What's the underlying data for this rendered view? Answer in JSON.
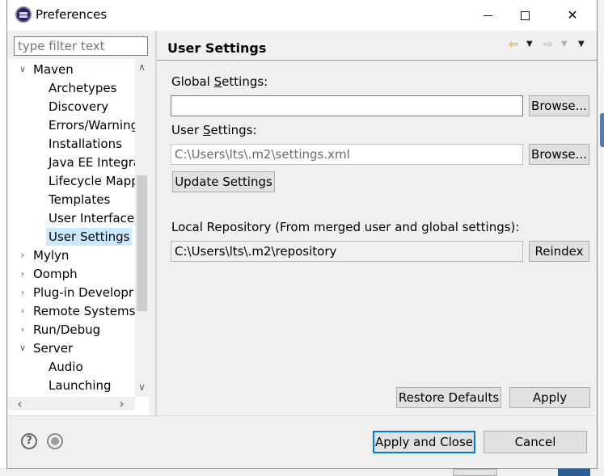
{
  "window": {
    "title": "Preferences",
    "minimize_glyph": "—",
    "close_glyph": "✕"
  },
  "filter": {
    "placeholder": "type filter text"
  },
  "tree": {
    "items": [
      {
        "label": "Maven",
        "expanded": true
      },
      {
        "label": "Archetypes"
      },
      {
        "label": "Discovery"
      },
      {
        "label": "Errors/Warning"
      },
      {
        "label": "Installations"
      },
      {
        "label": "Java EE Integra"
      },
      {
        "label": "Lifecycle Mapp"
      },
      {
        "label": "Templates"
      },
      {
        "label": "User Interface"
      },
      {
        "label": "User Settings",
        "selected": true
      },
      {
        "label": "Mylyn",
        "expanded": false
      },
      {
        "label": "Oomph",
        "expanded": false
      },
      {
        "label": "Plug-in Developr",
        "expanded": false
      },
      {
        "label": "Remote Systems",
        "expanded": false
      },
      {
        "label": "Run/Debug",
        "expanded": false
      },
      {
        "label": "Server",
        "expanded": true
      },
      {
        "label": "Audio"
      },
      {
        "label": "Launching"
      }
    ]
  },
  "page": {
    "title": "User Settings",
    "global_settings_label_pre": "Global ",
    "global_settings_label_mnemonic": "S",
    "global_settings_label_post": "ettings:",
    "global_settings_value": "",
    "browse_label": "Browse...",
    "user_settings_label_pre": "User ",
    "user_settings_label_mnemonic": "S",
    "user_settings_label_post": "ettings:",
    "user_settings_value": "C:\\Users\\lts\\.m2\\settings.xml",
    "update_settings_label": "Update Settings",
    "local_repo_label": "Local Repository (From merged user and global settings):",
    "local_repo_value": "C:\\Users\\lts\\.m2\\repository",
    "reindex_label": "Reindex",
    "restore_defaults_label": "Restore Defaults",
    "apply_label": "Apply"
  },
  "footer": {
    "help_glyph": "?",
    "apply_close_label": "Apply and Close",
    "cancel_label": "Cancel"
  },
  "colors": {
    "selection": "#cce8ff",
    "default_button_border": "#0078d7",
    "dialog_bg": "#f0f0f0"
  }
}
